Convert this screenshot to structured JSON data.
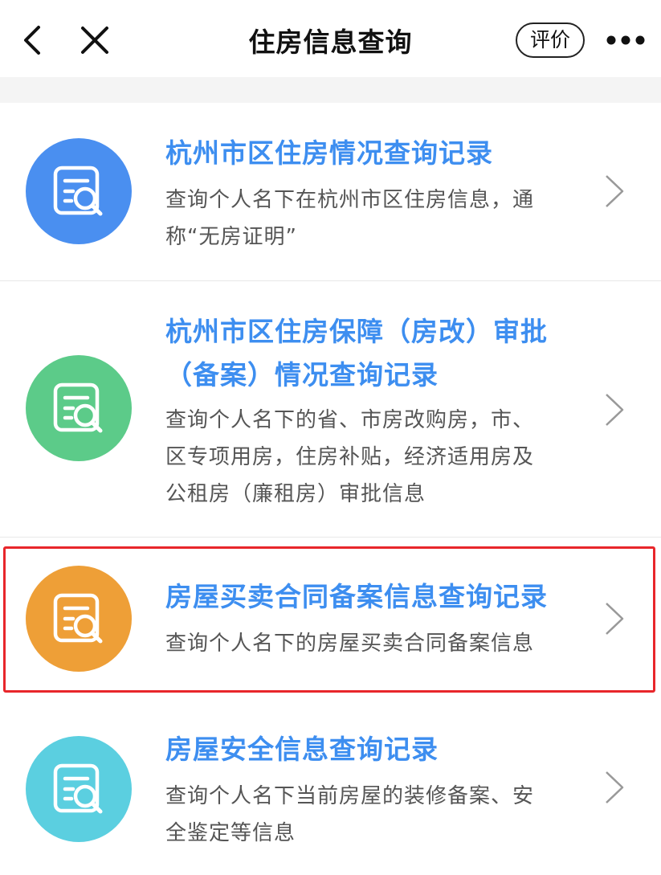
{
  "nav": {
    "title": "住房信息查询",
    "rate_label": "评价",
    "back_icon": "chevron-left-icon",
    "close_icon": "close-icon",
    "more_icon": "more-dots-icon"
  },
  "colors": {
    "title_blue": "#3d8ef0",
    "circle_blue": "#4a8ff0",
    "circle_green": "#5ccb89",
    "circle_orange": "#ee9f37",
    "circle_cyan": "#5bcfe0",
    "highlight_red": "#e8262b"
  },
  "items": [
    {
      "title_lines": [
        "杭州市区住房情况查询记录"
      ],
      "desc_lines": [
        "查询个人名下在杭州市区住房信息，通",
        "称“无房证明”"
      ],
      "icon": "document-search-icon"
    },
    {
      "title_lines": [
        "杭州市区住房保障（房改）审批",
        "（备案）情况查询记录"
      ],
      "desc_lines": [
        "查询个人名下的省、市房改购房，市、",
        "区专项用房，住房补贴，经济适用房及",
        "公租房（廉租房）审批信息"
      ],
      "icon": "document-search-icon"
    },
    {
      "title_lines": [
        "房屋买卖合同备案信息查询记录"
      ],
      "desc_lines": [
        "查询个人名下的房屋买卖合同备案信息"
      ],
      "icon": "document-search-icon",
      "highlighted": true
    },
    {
      "title_lines": [
        "房屋安全信息查询记录"
      ],
      "desc_lines": [
        "查询个人名下当前房屋的装修备案、安",
        "全鉴定等信息"
      ],
      "icon": "document-search-icon"
    }
  ]
}
